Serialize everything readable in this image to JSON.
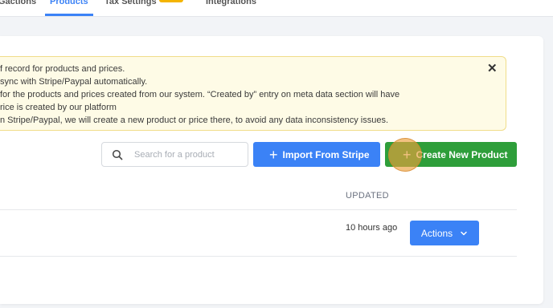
{
  "tabs": [
    {
      "label": "Gactions",
      "active": false
    },
    {
      "label": "Products",
      "active": true
    },
    {
      "label": "Tax Settings",
      "active": false
    },
    {
      "label": "Integrations",
      "active": false
    }
  ],
  "notice": {
    "lines": [
      "f record for products and prices.",
      "sync with Stripe/Paypal automatically.",
      " for the products and prices created from our system. “Created by” entry on meta data section will have",
      "rice is created by our platform",
      "n Stripe/Paypal, we will create a new product or price there, to avoid any data inconsistency issues."
    ],
    "close": "✕"
  },
  "toolbar": {
    "search_placeholder": "Search for a product",
    "search_value": "",
    "import_label": "Import From Stripe",
    "create_label": "Create New Product",
    "plus": "+"
  },
  "table": {
    "updated_header": "UPDATED",
    "rows": [
      {
        "updated": "10 hours ago",
        "actions_label": "Actions"
      }
    ]
  },
  "colors": {
    "primary": "#3b82f6",
    "success": "#2e9e3a",
    "notice_bg": "#fefbe6",
    "badge": "#f4b400"
  }
}
